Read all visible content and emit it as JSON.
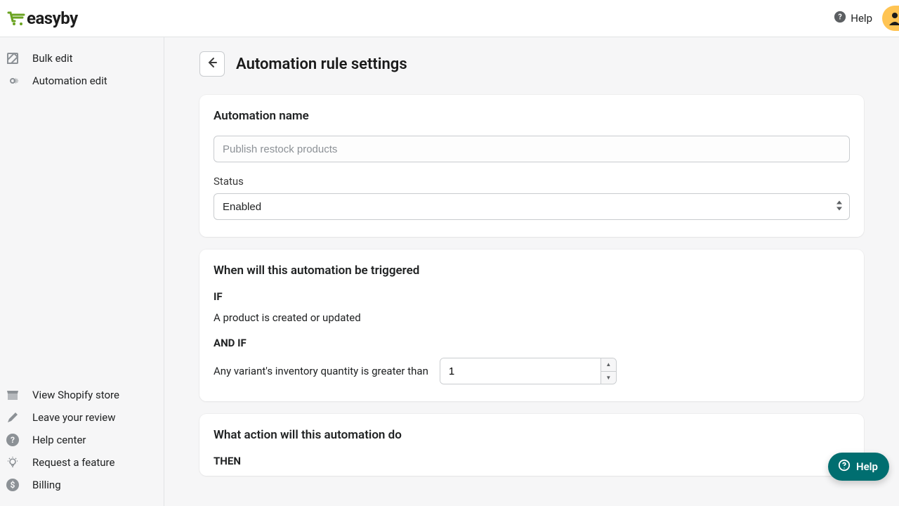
{
  "brand": {
    "name": "easyby"
  },
  "topbar": {
    "help_label": "Help"
  },
  "sidebar": {
    "top": [
      {
        "label": "Bulk edit"
      },
      {
        "label": "Automation edit"
      }
    ],
    "bottom": [
      {
        "label": "View Shopify store"
      },
      {
        "label": "Leave your review"
      },
      {
        "label": "Help center"
      },
      {
        "label": "Request a feature"
      },
      {
        "label": "Billing"
      }
    ]
  },
  "page": {
    "title": "Automation rule settings"
  },
  "automation": {
    "name_section_title": "Automation name",
    "name_placeholder": "Publish restock products",
    "name_value": "",
    "status_label": "Status",
    "status_selected": "Enabled"
  },
  "trigger": {
    "section_title": "When will this automation be triggered",
    "if_label": "IF",
    "if_text": "A product is created or updated",
    "and_if_label": "AND IF",
    "and_if_text": "Any variant's inventory quantity is greater than",
    "quantity_value": "1"
  },
  "action": {
    "section_title": "What action will this automation do",
    "then_label": "THEN"
  },
  "fab": {
    "label": "Help"
  }
}
